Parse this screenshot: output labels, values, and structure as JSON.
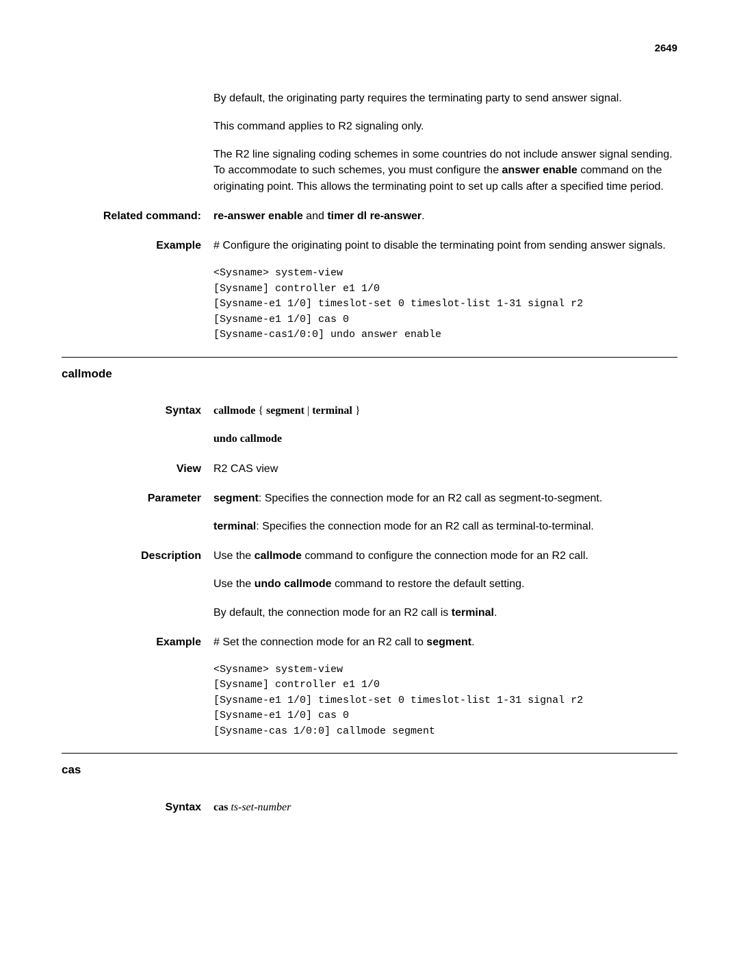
{
  "page_number": "2649",
  "section1": {
    "paragraphs": {
      "p1": "By default, the originating party requires the terminating party to send answer signal.",
      "p2": "This command applies to R2 signaling only.",
      "p3_part1": "The R2 line signaling coding schemes in some countries do not include answer signal sending. To accommodate to such schemes, you must configure the ",
      "p3_bold": "answer enable",
      "p3_part2": " command on the originating point. This allows the terminating point to set up calls after a specified time period."
    },
    "related_command": {
      "label": "Related command:",
      "bold1": "re-answer enable",
      "mid": " and ",
      "bold2": "timer dl re-answer",
      "end": "."
    },
    "example": {
      "label": "Example",
      "desc": "# Configure the originating point to disable the terminating point from sending answer signals.",
      "code": "<Sysname> system-view\n[Sysname] controller e1 1/0\n[Sysname-e1 1/0] timeslot-set 0 timeslot-list 1-31 signal r2\n[Sysname-e1 1/0] cas 0\n[Sysname-cas1/0:0] undo answer enable"
    }
  },
  "section2": {
    "heading": "callmode",
    "syntax": {
      "label": "Syntax",
      "line1_bold1": "callmode",
      "line1_mid1": " { ",
      "line1_bold2": "segment",
      "line1_mid2": " | ",
      "line1_bold3": "terminal",
      "line1_end": " }",
      "line2": "undo callmode"
    },
    "view": {
      "label": "View",
      "text": "R2 CAS view"
    },
    "parameter": {
      "label": "Parameter",
      "p1_bold": "segment",
      "p1_text": ": Specifies the connection mode for an R2 call as segment-to-segment.",
      "p2_bold": "terminal",
      "p2_text": ": Specifies the connection mode for an R2 call as terminal-to-terminal."
    },
    "description": {
      "label": "Description",
      "p1_part1": "Use the ",
      "p1_bold": "callmode",
      "p1_part2": " command to configure the connection mode for an R2 call.",
      "p2_part1": "Use the ",
      "p2_bold": "undo callmode",
      "p2_part2": " command to restore the default setting.",
      "p3_part1": "By default, the connection mode for an R2 call is ",
      "p3_bold": "terminal",
      "p3_end": "."
    },
    "example": {
      "label": "Example",
      "desc_part1": "# Set the connection mode for an R2 call to ",
      "desc_bold": "segment",
      "desc_end": ".",
      "code": "<Sysname> system-view\n[Sysname] controller e1 1/0\n[Sysname-e1 1/0] timeslot-set 0 timeslot-list 1-31 signal r2\n[Sysname-e1 1/0] cas 0\n[Sysname-cas 1/0:0] callmode segment"
    }
  },
  "section3": {
    "heading": "cas",
    "syntax": {
      "label": "Syntax",
      "bold": "cas",
      "italic": " ts-set-number"
    }
  }
}
